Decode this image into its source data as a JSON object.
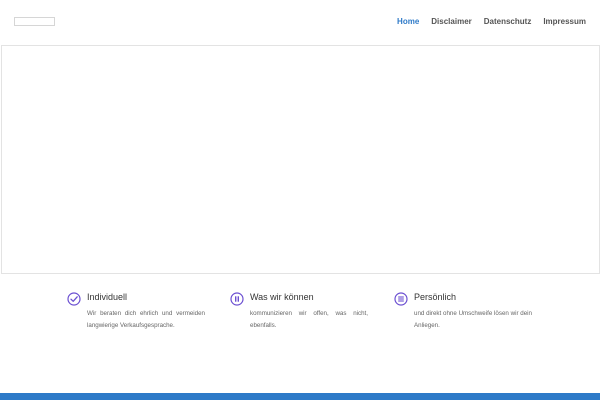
{
  "nav": {
    "items": [
      {
        "label": "Home",
        "active": true
      },
      {
        "label": "Disclaimer",
        "active": false
      },
      {
        "label": "Datenschutz",
        "active": false
      },
      {
        "label": "Impressum",
        "active": false
      }
    ]
  },
  "features": [
    {
      "icon": "check-circle-icon",
      "title": "Individuell",
      "text": "Wir beraten dich ehrlich und vermeiden langwierige Verkaufsgesprache."
    },
    {
      "icon": "pause-circle-icon",
      "title": "Was wir können",
      "text": "kommunizieren wir offen, was nicht, ebenfalls."
    },
    {
      "icon": "list-circle-icon",
      "title": "Persönlich",
      "text": "und direkt ohne Umschweife lösen wir dein Anliegen."
    }
  ],
  "colors": {
    "accent": "#2e7ac8",
    "icon": "#6b4fd1"
  }
}
